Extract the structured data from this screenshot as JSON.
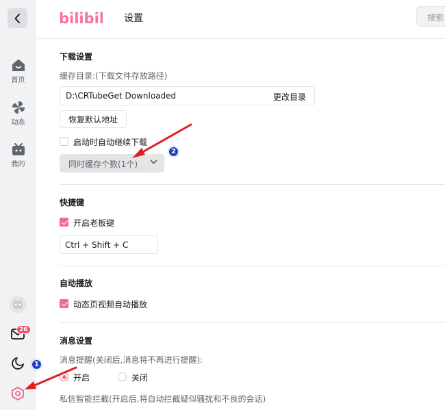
{
  "app": {
    "logo_text": "bilibili",
    "page_title": "设置",
    "search_placeholder": "搜索"
  },
  "sidebar": {
    "items": [
      {
        "label": "首页",
        "icon": "home-icon"
      },
      {
        "label": "动态",
        "icon": "pinwheel-icon"
      },
      {
        "label": "我的",
        "icon": "tv-icon"
      }
    ],
    "message_badge": "26",
    "bottom_icons": [
      "avatar",
      "mail-icon",
      "moon-icon",
      "settings-icon"
    ]
  },
  "download": {
    "title": "下载设置",
    "cache_label": "缓存目录:(下载文件存放路径)",
    "path_value": "D:\\CRTubeGet Downloaded",
    "change_button": "更改目录",
    "restore_button": "恢复默认地址",
    "auto_resume_label": "启动时自动继续下载",
    "auto_resume_checked": false,
    "concurrent_select": "同时缓存个数(1个)"
  },
  "shortcuts": {
    "title": "快捷键",
    "boss_key_label": "开启老板键",
    "boss_key_checked": true,
    "boss_key_value": "Ctrl + Shift + C"
  },
  "autoplay": {
    "title": "自动播放",
    "feed_autoplay_label": "动态页视频自动播放",
    "feed_autoplay_checked": true
  },
  "messages": {
    "title": "消息设置",
    "reminder_label": "消息提醒(关闭后,消息将不再进行提醒):",
    "option_on": "开启",
    "option_off": "关闭",
    "selected": "开启",
    "dm_filter_label": "私信智能拦截(开启后,将自动拦截疑似骚扰和不良的会话)"
  },
  "annotations": {
    "marker_1": "1",
    "marker_2": "2",
    "arrow_color": "#e02020",
    "marker_color": "#1a3ec4"
  },
  "colors": {
    "accent_pink": "#f36b8b",
    "brand_pink": "#fb7299",
    "sidebar_bg": "#f1f2f3"
  }
}
